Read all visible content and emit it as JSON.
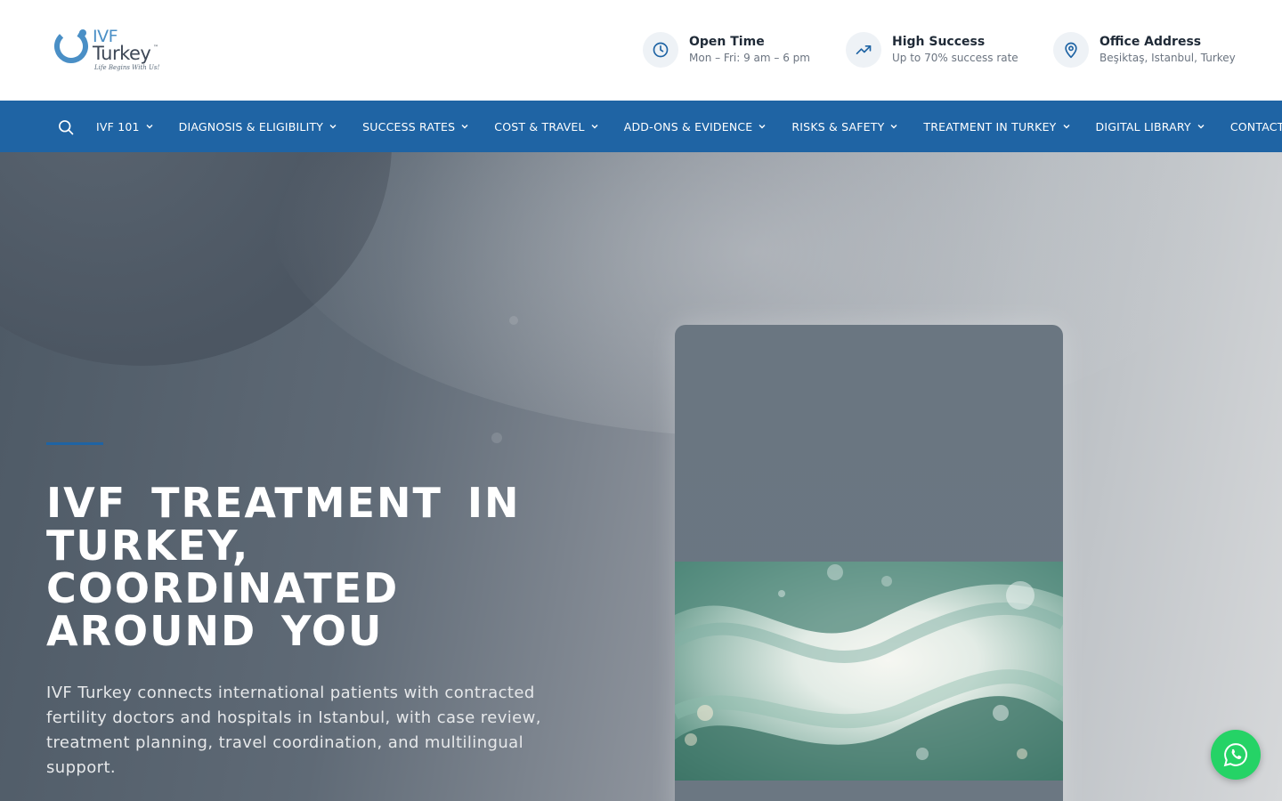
{
  "logo": {
    "brand_line1": "IVF",
    "brand_line2": "Turkey",
    "trademark": "™",
    "tagline": "Life Begins With Us!"
  },
  "header_info": [
    {
      "icon": "clock-icon",
      "title": "Open Time",
      "subtitle": "Mon – Fri: 9 am – 6 pm"
    },
    {
      "icon": "trending-up-icon",
      "title": "High Success",
      "subtitle": "Up to 70% success rate"
    },
    {
      "icon": "map-pin-icon",
      "title": "Office Address",
      "subtitle": "Beşiktaş, Istanbul, Turkey"
    }
  ],
  "nav": {
    "items": [
      {
        "label": "IVF 101",
        "has_dropdown": true
      },
      {
        "label": "DIAGNOSIS & ELIGIBILITY",
        "has_dropdown": true
      },
      {
        "label": "SUCCESS RATES",
        "has_dropdown": true
      },
      {
        "label": "COST & TRAVEL",
        "has_dropdown": true
      },
      {
        "label": "ADD-ONS & EVIDENCE",
        "has_dropdown": true
      },
      {
        "label": "RISKS & SAFETY",
        "has_dropdown": true
      },
      {
        "label": "TREATMENT IN TURKEY",
        "has_dropdown": true
      },
      {
        "label": "DIGITAL LIBRARY",
        "has_dropdown": true
      },
      {
        "label": "CONTACT",
        "has_dropdown": false
      }
    ]
  },
  "hero": {
    "title": "IVF TREATMENT IN TURKEY, COORDINATED AROUND YOU",
    "description": "IVF Turkey connects international patients with contracted fertility doctors and hospitals in Istanbul, with case review, treatment planning, travel coordination, and multilingual support."
  },
  "colors": {
    "nav_bg": "#1f64a4",
    "accent": "#1f64a4",
    "whatsapp": "#25d366"
  }
}
